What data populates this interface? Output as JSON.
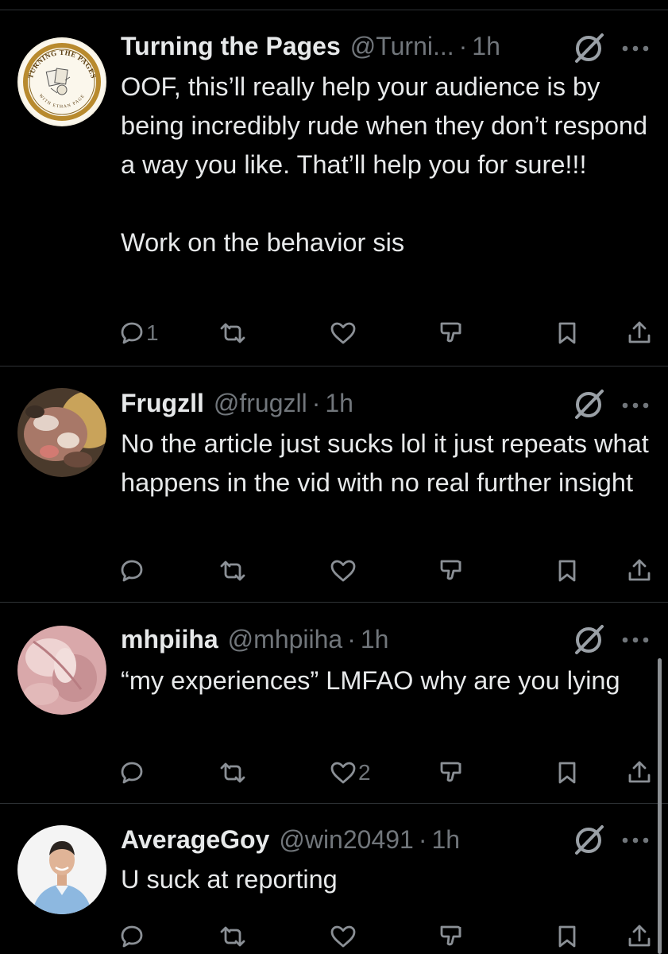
{
  "tweets": [
    {
      "name": "Turning the Pages",
      "handle": "@Turni...",
      "time": "1h",
      "text": "OOF, this’ll really help your audience is by being incredibly rude when they don’t respond a way you like. That’ll help you for sure!!!\n\nWork on the behavior sis",
      "reply_count": "1",
      "like_count": "",
      "avatar_logo": {
        "top_text": "TURNING THE PAGES",
        "bottom_text": "WITH ETHAN PAGE"
      }
    },
    {
      "name": "Frugzll",
      "handle": "@frugzll",
      "time": "1h",
      "text": "No the article just sucks lol it just repeats what happens in the vid with no real further insight",
      "reply_count": "",
      "like_count": ""
    },
    {
      "name": "mhpiiha",
      "handle": "@mhpiiha",
      "time": "1h",
      "text": "“my experiences” LMFAO why are you lying",
      "reply_count": "",
      "like_count": "2"
    },
    {
      "name": "AverageGoy",
      "handle": "@win20491",
      "time": "1h",
      "text": "U suck at reporting",
      "reply_count": "",
      "like_count": ""
    }
  ],
  "separator": "·",
  "icons": {
    "reply": "reply-icon",
    "retweet": "retweet-icon",
    "like": "like-icon",
    "dislike": "dislike-icon",
    "bookmark": "bookmark-icon",
    "share": "share-icon",
    "grok": "grok-icon",
    "more": "more-icon"
  },
  "colors": {
    "background": "#000000",
    "text": "#e7e9ea",
    "muted": "#71767b",
    "divider": "#2f3336"
  }
}
